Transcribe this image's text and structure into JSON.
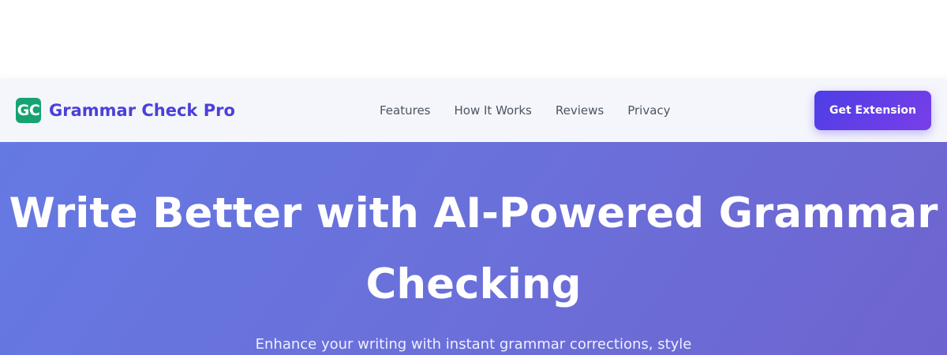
{
  "brand": {
    "logo_text": "GC",
    "name": "Grammar Check Pro"
  },
  "nav": {
    "items": [
      {
        "label": "Features"
      },
      {
        "label": "How It Works"
      },
      {
        "label": "Reviews"
      },
      {
        "label": "Privacy"
      }
    ],
    "cta_label": "Get Extension"
  },
  "hero": {
    "title": "Write Better with AI-Powered Grammar Checking",
    "subtitle": "Enhance your writing with instant grammar corrections, style"
  },
  "colors": {
    "brand_text": "#4b40d8",
    "logo_bg": "#16a371",
    "cta_start": "#4d3ee6",
    "cta_end": "#7a3ee8",
    "hero_bg": "#6b6fd9"
  }
}
